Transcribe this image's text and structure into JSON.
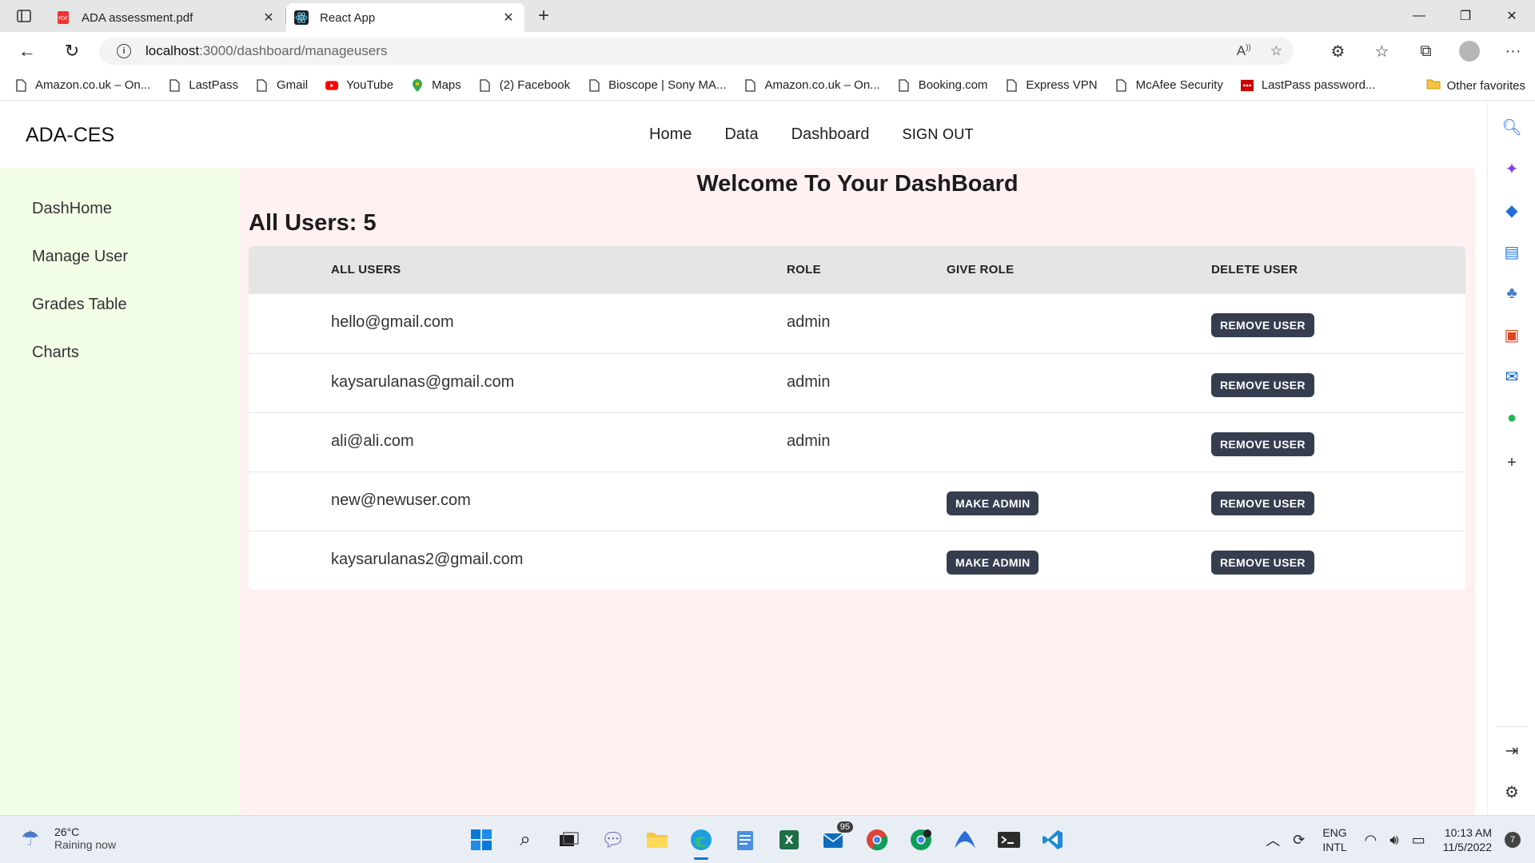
{
  "browser": {
    "tabs": [
      {
        "title": "ADA assessment.pdf",
        "icon": "pdf-icon",
        "active": false
      },
      {
        "title": "React App",
        "icon": "react-icon",
        "active": true
      }
    ],
    "address": {
      "host": "localhost",
      "path": ":3000/dashboard/manageusers"
    },
    "favorites": [
      "Amazon.co.uk – On...",
      "LastPass",
      "Gmail",
      "YouTube",
      "Maps",
      "(2) Facebook",
      "Bioscope | Sony MA...",
      "Amazon.co.uk – On...",
      "Booking.com",
      "Express VPN",
      "McAfee Security",
      "LastPass password..."
    ],
    "other_favorites": "Other favorites"
  },
  "app": {
    "brand": "ADA-CES",
    "nav": {
      "home": "Home",
      "data": "Data",
      "dashboard": "Dashboard",
      "signout": "SIGN OUT"
    },
    "sidebar": {
      "items": [
        "DashHome",
        "Manage User",
        "Grades Table",
        "Charts"
      ]
    },
    "welcome": "Welcome To Your DashBoard",
    "count_label": "All Users: 5",
    "table": {
      "headers": {
        "users": "ALL USERS",
        "role": "ROLE",
        "give_role": "GIVE ROLE",
        "delete": "DELETE USER"
      },
      "rows": [
        {
          "email": "hello@gmail.com",
          "role": "admin",
          "give": "",
          "remove": "REMOVE USER"
        },
        {
          "email": "kaysarulanas@gmail.com",
          "role": "admin",
          "give": "",
          "remove": "REMOVE USER"
        },
        {
          "email": "ali@ali.com",
          "role": "admin",
          "give": "",
          "remove": "REMOVE USER"
        },
        {
          "email": "new@newuser.com",
          "role": "",
          "give": "MAKE ADMIN",
          "remove": "REMOVE USER"
        },
        {
          "email": "kaysarulanas2@gmail.com",
          "role": "",
          "give": "MAKE ADMIN",
          "remove": "REMOVE USER"
        }
      ]
    }
  },
  "taskbar": {
    "weather": {
      "temp": "26°C",
      "desc": "Raining now"
    },
    "badge_count": "95",
    "lang": {
      "line1": "ENG",
      "line2": "INTL"
    },
    "time": "10:13 AM",
    "date": "11/5/2022",
    "notifications": "7"
  },
  "colors": {
    "sidebar_bg": "#f3fee6",
    "main_bg": "#fff1f1",
    "button_bg": "#353d4f",
    "table_header_bg": "#e5e5e5"
  }
}
